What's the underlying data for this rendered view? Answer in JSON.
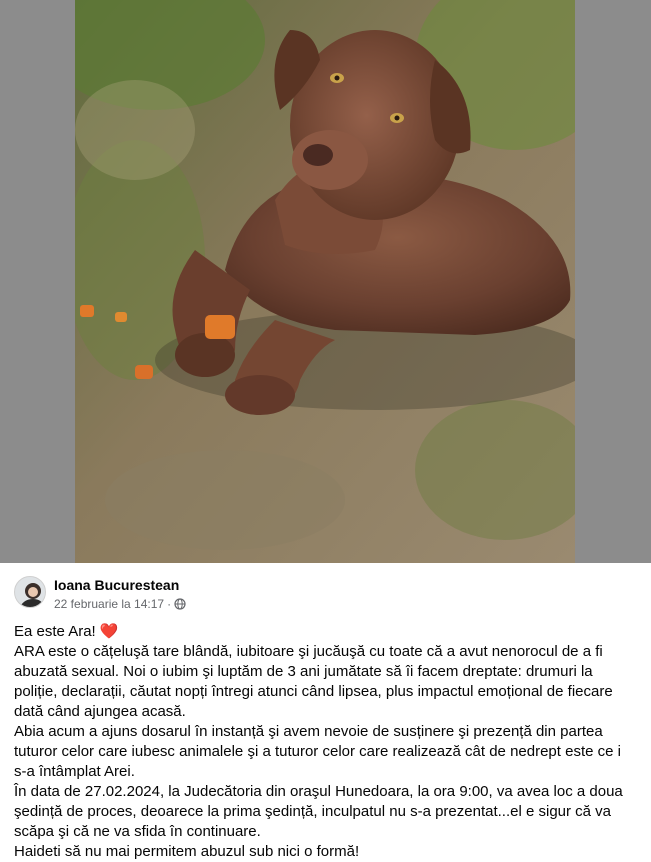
{
  "post": {
    "author": "Ioana Bucurestean",
    "timestamp": "22 februarie la 14:17",
    "separator": "·",
    "privacy_icon": "globe-icon",
    "paragraphs": [
      "Ea este Ara!",
      "ARA este o cățeluşă tare blândă, iubitoare şi jucăuşă cu toate că a avut nenorocul de a fi abuzată sexual. Noi o iubim şi luptăm de 3 ani jumătate să îi facem dreptate: drumuri la poliție, declarații, căutat nopți întregi atunci când lipsea, plus impactul emoțional de fiecare dată când ajungea acasă.",
      "Abia acum a ajuns dosarul în instanță şi avem nevoie de susținere şi prezență din partea tuturor celor care iubesc animalele şi a tuturor celor care realizează cât de nedrept este ce i s-a întâmplat Arei.",
      "În data de 27.02.2024, la Judecătoria din oraşul Hunedoara, la ora 9:00, va avea loc a doua şedință de proces, deoarece la prima şedință, inculpatul nu s-a prezentat...el e sigur că va scăpa şi că ne va sfida în continuare.",
      "Haideti să nu mai permitem abuzul sub nici o formă!"
    ],
    "heart_emoji": "❤️"
  },
  "colors": {
    "photo_backdrop": "#8c8c8c",
    "meta_text": "#65676b",
    "heart": "#e0245e"
  }
}
